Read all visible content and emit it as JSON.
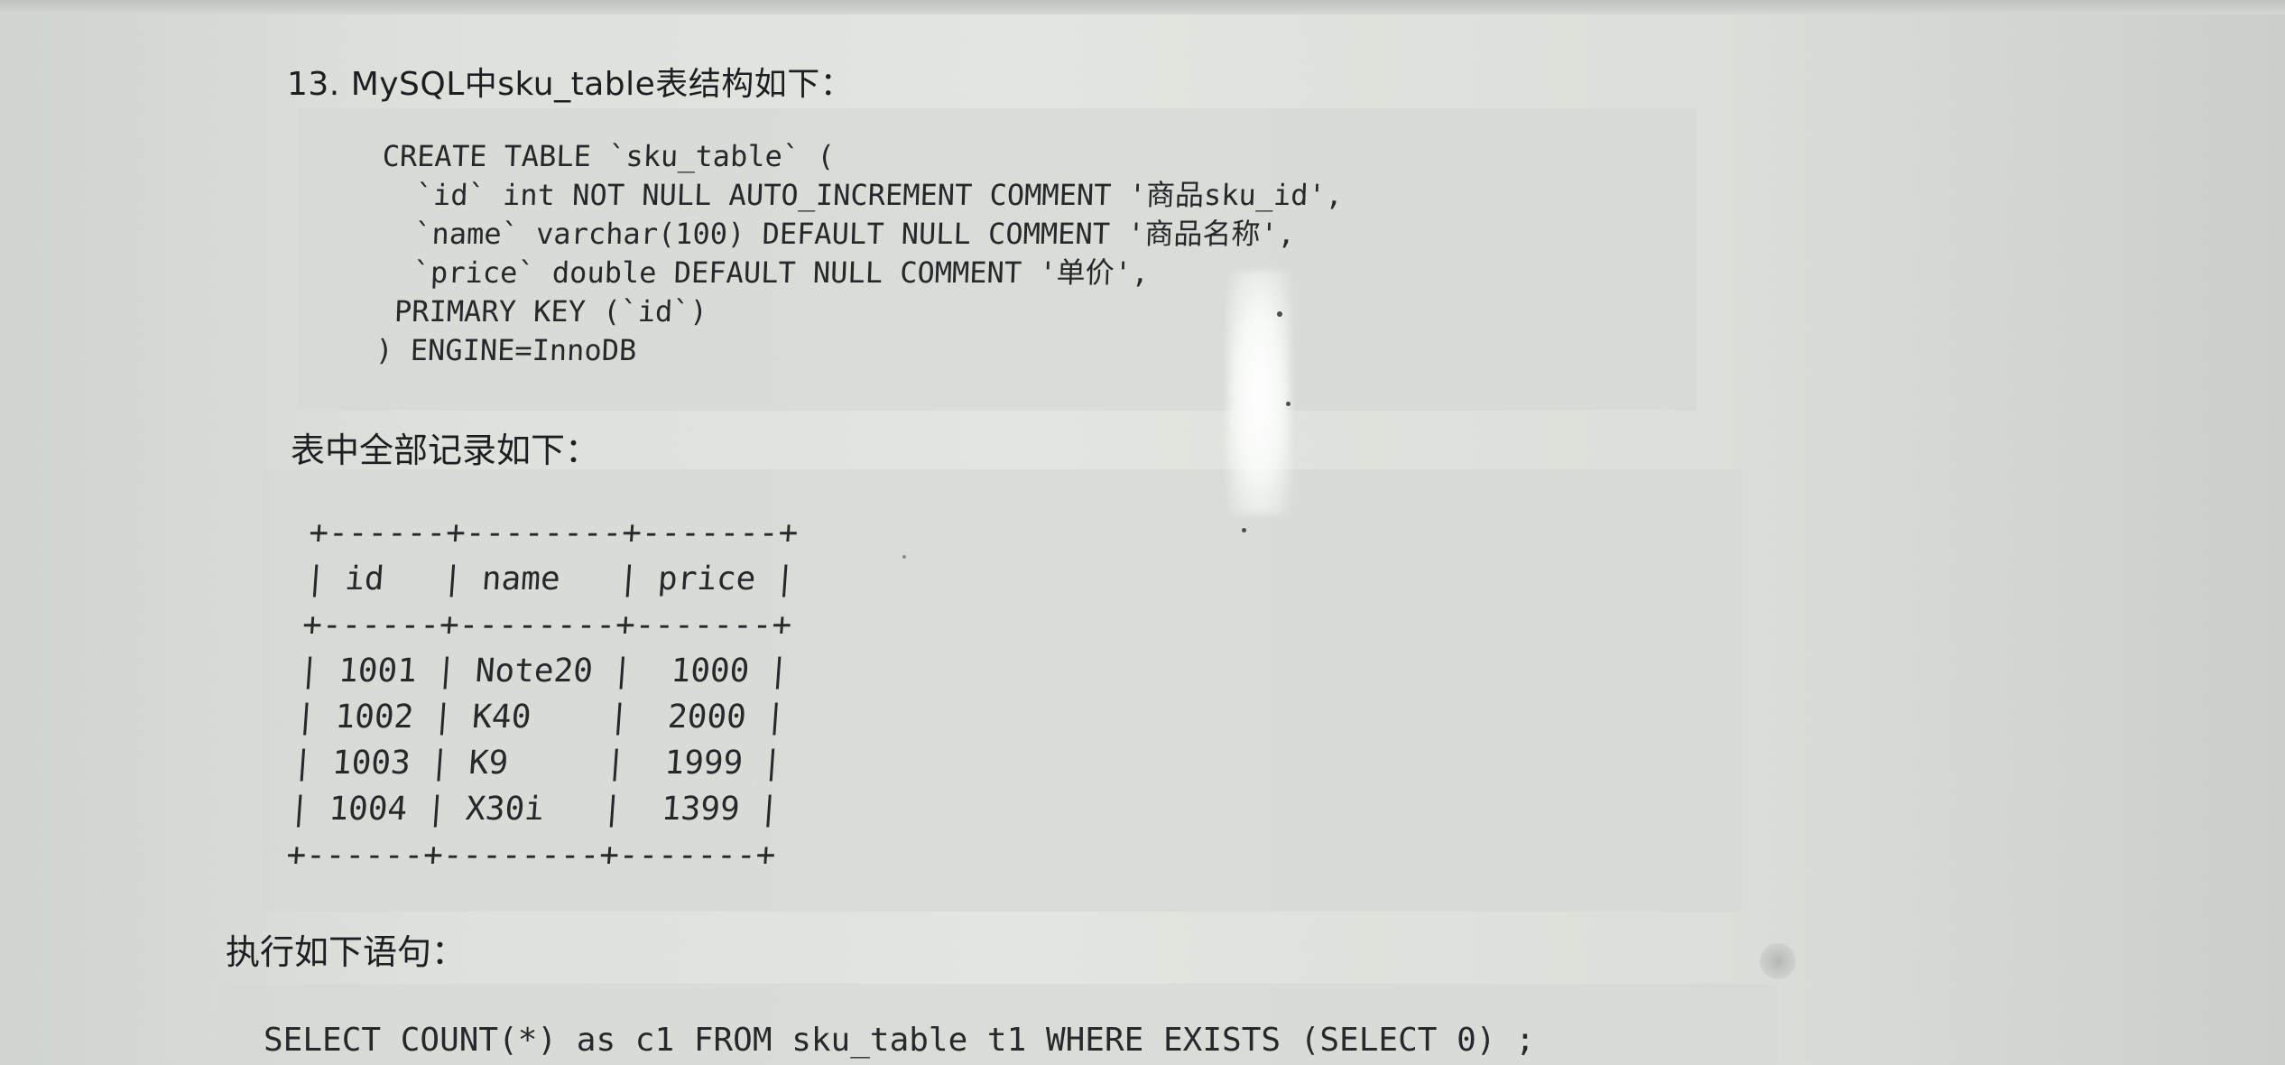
{
  "question": {
    "title": "13. MySQL中sku_table表结构如下："
  },
  "create_statement": {
    "lines": [
      "CREATE TABLE `sku_table` (",
      "  `id` int NOT NULL AUTO_INCREMENT COMMENT '商品sku_id',",
      "  `name` varchar(100) DEFAULT NULL COMMENT '商品名称',",
      "  `price` double DEFAULT NULL COMMENT '单价',",
      " PRIMARY KEY (`id`)",
      ") ENGINE=InnoDB"
    ]
  },
  "records": {
    "label": "表中全部记录如下：",
    "border": "+------+--------+-------+",
    "columns": [
      "id",
      "name",
      "price"
    ],
    "rows": [
      [
        "1001",
        "Note20",
        "1000"
      ],
      [
        "1002",
        "K40",
        "2000"
      ],
      [
        "1003",
        "K9",
        "1999"
      ],
      [
        "1004",
        "X30i",
        "1399"
      ]
    ]
  },
  "execute": {
    "label": "执行如下语句：",
    "statement": "SELECT COUNT(*) as c1 FROM sku_table t1 WHERE EXISTS (SELECT 0) ;"
  }
}
